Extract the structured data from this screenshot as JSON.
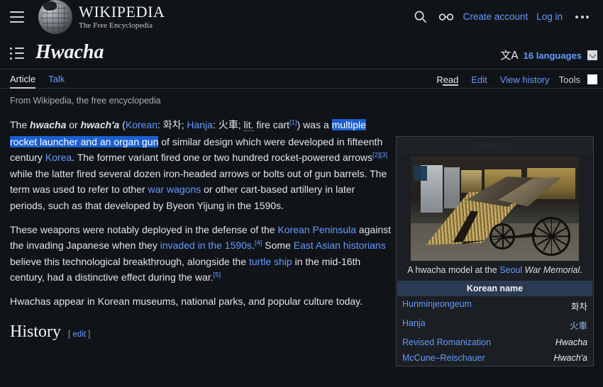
{
  "header": {
    "menu_icon": "hamburger-icon",
    "wordmark": "WIKIPEDIA",
    "tagline": "The Free Encyclopedia",
    "search_icon": "search-icon",
    "appearance_icon": "glasses-icon",
    "create_account": "Create account",
    "log_in": "Log in",
    "more_icon": "ellipsis-icon"
  },
  "title_row": {
    "toc_icon": "table-of-contents-icon",
    "title": "Hwacha",
    "language_icon": "文A",
    "language_label": "16 languages",
    "language_chevron": "chevron-down-icon"
  },
  "tabs": {
    "left": [
      {
        "label": "Article",
        "active": true
      },
      {
        "label": "Talk",
        "active": false
      }
    ],
    "right": [
      {
        "label": "Read",
        "active": true
      },
      {
        "label": "Edit",
        "active": false
      },
      {
        "label": "View history",
        "active": false
      }
    ],
    "tools_label": "Tools"
  },
  "content": {
    "site_sub": "From Wikipedia, the free encyclopedia",
    "p1": {
      "t1": "The ",
      "bold1": "hwacha",
      "t2": " or ",
      "bold2": "hwach'a",
      "t3": " (",
      "korean_link": "Korean",
      "t4": ": ",
      "korean_text": "화차",
      "t5": "; ",
      "hanja_link": "Hanja",
      "t6": ": ",
      "hanja_text": "火車",
      "t7": "; ",
      "lit_abbr": "lit.",
      "t8": " fire cart",
      "ref1": "[1]",
      "t9": ") was a ",
      "sel1": "multiple",
      "sel2": "rocket launcher and an organ gun",
      "t10": " of similar design which were developed in fifteenth century ",
      "korea_link": "Korea",
      "t11": ". The former variant fired one or two hundred rocket-powered arrows",
      "ref2": "[2]",
      "ref3": "[3]",
      "t12": " while the latter fired several dozen iron-headed arrows or bolts out of gun barrels. The term was used to refer to other ",
      "warwagons_link": "war wagons",
      "t13": " or other cart-based artillery in later periods, such as that developed by Byeon Yijung in the 1590s."
    },
    "p2": {
      "t1": "These weapons were notably deployed in the defense of the ",
      "peninsula_link": "Korean Peninsula",
      "t2": " against the invading Japanese when they ",
      "invaded_link": "invaded in the 1590s",
      "ref4": "[4]",
      "t3": " Some ",
      "historians_link": "East Asian historians",
      "t4": " believe this technological breakthrough, alongside the ",
      "turtle_link": "turtle ship",
      "t5": " in the mid-16th century, had a distinctive effect during the war.",
      "ref5": "[5]"
    },
    "p3": "Hwachas appear in Korean museums, national parks, and popular culture today.",
    "section_history": "History",
    "edit_open": "[",
    "edit_label": "edit",
    "edit_close": "]"
  },
  "infobox": {
    "title": "Hwacha",
    "image_alt": "hwacha-model-photo",
    "caption_t1": "A hwacha model at the ",
    "caption_link": "Seoul",
    "caption_t2": " War Memorial",
    "caption_t3": ".",
    "korean_name_header": "Korean name",
    "rows": [
      {
        "label": "Hunminjeongeum",
        "value": "화차",
        "style": "plain"
      },
      {
        "label": "Hanja",
        "value": "火車",
        "style": "hanja"
      },
      {
        "label": "Revised Romanization",
        "value": "Hwacha",
        "style": "italic"
      },
      {
        "label": "McCune–Reischauer",
        "value": "Hwach'a",
        "style": "italic"
      }
    ]
  },
  "colors": {
    "page_bg": "#101418",
    "link": "#6699ff",
    "selection": "#1b5fce",
    "infobox_bg": "#1b1f23",
    "korean_header": "#2a3a52"
  }
}
